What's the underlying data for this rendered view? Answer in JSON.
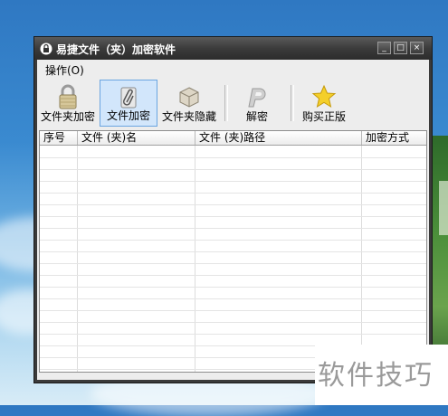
{
  "window": {
    "title": "易捷文件（夹）加密软件",
    "controls": {
      "minimize": "_",
      "maximize": "□",
      "close": "×"
    }
  },
  "menu": {
    "items": [
      {
        "label": "操作(O)"
      }
    ]
  },
  "toolbar": {
    "buttons": [
      {
        "label": "文件夹加密",
        "icon": "lock-icon",
        "active": false
      },
      {
        "label": "文件加密",
        "icon": "paperclip-document-icon",
        "active": true
      },
      {
        "label": "文件夹隐藏",
        "icon": "box-icon",
        "active": false
      },
      {
        "label": "解密",
        "icon": "decrypt-p-icon",
        "active": false
      },
      {
        "label": "购买正版",
        "icon": "star-icon",
        "active": false
      }
    ]
  },
  "list": {
    "columns": [
      "序号",
      "文件 (夹)名",
      "文件 (夹)路径",
      "加密方式"
    ],
    "rows": []
  },
  "watermark": {
    "text": "软件技巧"
  },
  "colors": {
    "active_button_bg": "#d2e6fb",
    "active_button_border": "#6aa5e0",
    "titlebar": "#3b3b3b"
  }
}
